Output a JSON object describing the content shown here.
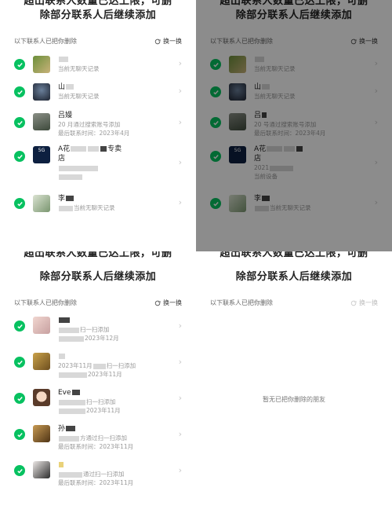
{
  "panels": [
    {
      "title_cut": "超出联系人数量已达上限，可删",
      "title_line2": "除部分联系人后继续添加",
      "header_label": "以下联系人已把你删除",
      "swap_label": "换一换",
      "rows": [
        {
          "name": "",
          "sub": "当前无聊天记录"
        },
        {
          "name": "山",
          "sub": "当前无聊天记录"
        },
        {
          "name": "吕嫚",
          "sub": "20 月通过搜索账号添加",
          "sub2": "最后联系时间：2023年4月"
        },
        {
          "name": "A花",
          "name2": "专卖",
          "name3": "店",
          "sub": "",
          "sub2": ""
        },
        {
          "name": "李",
          "sub": "当前无聊天记录"
        }
      ]
    },
    {
      "title_cut": "超出联系人数量已达上限，可删",
      "title_line2": "除部分联系人后继续添加",
      "header_label": "以下联系人已把你删除",
      "swap_label": "换一换",
      "rows": [
        {
          "name": "",
          "sub": "当前无聊天记录"
        },
        {
          "name": "山",
          "sub": "当前无聊天记录"
        },
        {
          "name": "吕",
          "sub": "20 号通过搜索账号添加",
          "sub2": "最后联系时间：2023年4月"
        },
        {
          "name": "A花",
          "name3": "店",
          "sub": "2021",
          "sub2": "当前设备"
        },
        {
          "name": "李",
          "sub": "当前无聊天记录"
        }
      ]
    },
    {
      "title_cut": "超出联系人数量已达上限，可删",
      "title_line2": "除部分联系人后继续添加",
      "header_label": "以下联系人已把你删除",
      "swap_label": "换一换",
      "rows": [
        {
          "name": "",
          "sub": "扫一扫添加",
          "sub2": "2023年12月"
        },
        {
          "name": "",
          "sub": "2023年11月",
          "sub2": "扫一扫添加",
          "sub3": "2023年11月"
        },
        {
          "name": "Eve",
          "sub": "扫一扫添加",
          "sub2": "2023年11月"
        },
        {
          "name": "孙",
          "sub": "方通过扫一扫添加",
          "sub2": "最后联系时间：2023年11月"
        },
        {
          "name": "",
          "sub": "通过扫一扫添加",
          "sub2": "最后联系时间：2023年11月"
        }
      ]
    },
    {
      "title_cut": "超出联系人数量已达上限，可删",
      "title_line2": "除部分联系人后继续添加",
      "header_label": "以下联系人已把你删除",
      "swap_label": "换一换",
      "empty_text": "暂无已把你删除的朋友"
    }
  ],
  "colors": {
    "check": "#07c160",
    "shade": "rgba(0,0,0,0.45)"
  },
  "icons": {
    "check": "checkmark-icon",
    "refresh": "refresh-icon",
    "chevron": "chevron-right-icon"
  }
}
